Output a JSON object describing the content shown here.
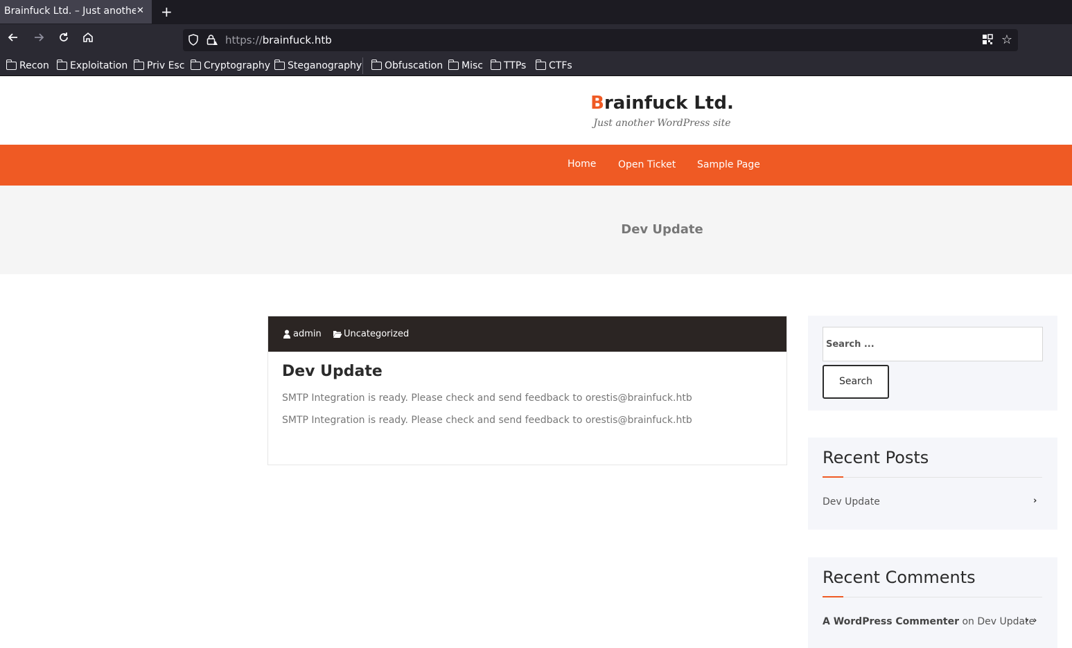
{
  "browser": {
    "tab_title": "Brainfuck Ltd. – Just another WordPress site",
    "tab_close": "✕",
    "new_tab": "+",
    "url_scheme": "https://",
    "url_host": "brainfuck.htb",
    "bookmarks": [
      "Recon",
      "Exploitation",
      "Priv Esc",
      "Cryptography",
      "Steganography",
      "Obfuscation",
      "Misc",
      "TTPs",
      "CTFs"
    ]
  },
  "site": {
    "title_initial": "B",
    "title_rest": "rainfuck Ltd.",
    "tagline": "Just another WordPress site",
    "nav": [
      "Home",
      "Open Ticket",
      "Sample Page"
    ],
    "banner_title": "Dev Update",
    "accent_color": "#ef5a24"
  },
  "post": {
    "author": "admin",
    "category": "Uncategorized",
    "title": "Dev Update",
    "paragraphs": [
      "SMTP Integration is ready. Please check and send feedback to orestis@brainfuck.htb",
      "SMTP Integration is ready. Please check and send feedback to orestis@brainfuck.htb"
    ]
  },
  "sidebar": {
    "search_placeholder": "Search ...",
    "search_button": "Search",
    "recent_posts_title": "Recent Posts",
    "recent_posts": [
      "Dev Update"
    ],
    "recent_comments_title": "Recent Comments",
    "comment_author": "A WordPress Commenter",
    "comment_on": "on",
    "comment_post": "Dev Update"
  }
}
